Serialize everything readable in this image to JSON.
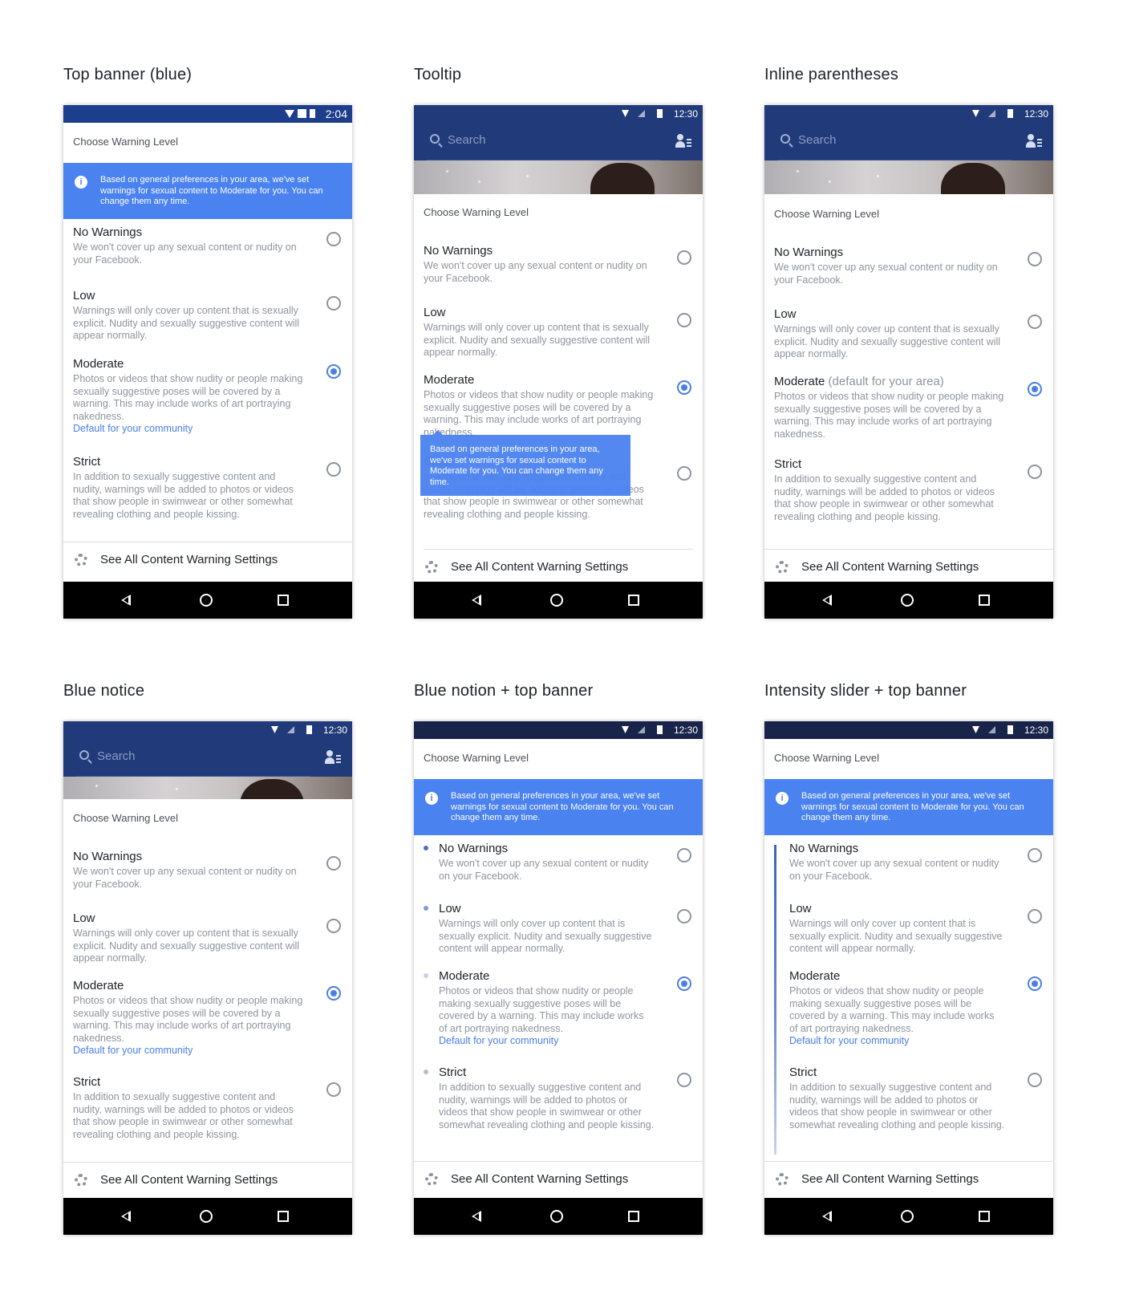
{
  "titles": [
    "Top banner (blue)",
    "Tooltip",
    "Inline parentheses",
    "Blue notice",
    "Blue notion + top banner",
    "Intensity slider + top banner"
  ],
  "status": {
    "time_a": "2:04",
    "time_b": "12:30"
  },
  "search_placeholder": "Search",
  "header": "Choose Warning Level",
  "banner": "Based on general preferences in your area, we've set warnings for sexual content to Moderate for you. You can change them any time.",
  "options": [
    {
      "title": "No Warnings",
      "desc": "We won't cover up any sexual content or nudity on your Facebook."
    },
    {
      "title": "Low",
      "desc": "Warnings will only cover up content that is sexually explicit. Nudity and sexually suggestive content will appear normally."
    },
    {
      "title": "Moderate",
      "desc": "Photos or videos that show nudity or people making sexually suggestive poses will be covered by a warning. This may include works of art portraying nakedness."
    },
    {
      "title": "Strict",
      "desc": "In addition to sexually suggestive content and nudity, warnings will be added to photos or videos that show people in swimwear or other somewhat revealing clothing and people kissing."
    }
  ],
  "default_link": "Default for your community",
  "default_area": "(default for your area)",
  "see_all": "See All Content Warning Settings",
  "colors": {
    "accent": "#4a82f0",
    "statusbar": "#213a7a"
  }
}
